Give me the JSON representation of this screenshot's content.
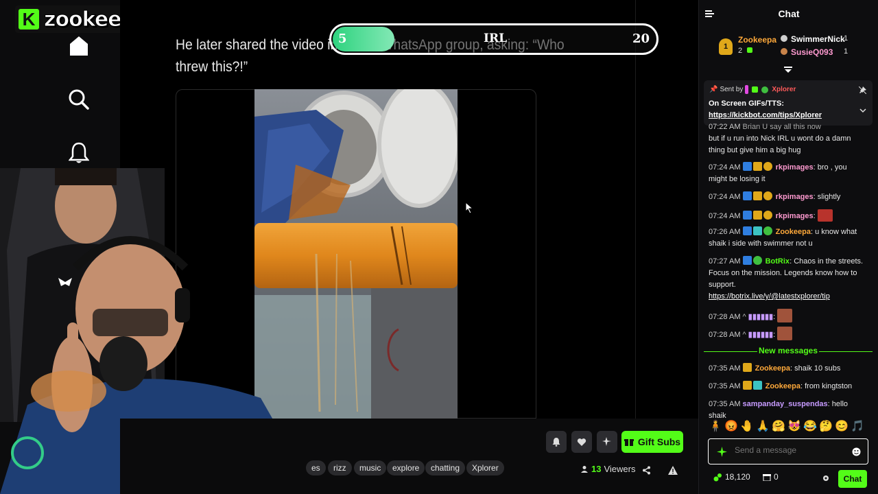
{
  "brand": {
    "logo_letter": "K",
    "logo_text": "zookeepa"
  },
  "nav": {
    "icons": [
      "home-icon",
      "search-icon",
      "bell-icon"
    ]
  },
  "article": {
    "text": "He later shared the video in a staff WhatsApp group, asking: “Who threw this?!”"
  },
  "overlay": {
    "left_value": "5",
    "center_label": "IRL",
    "right_value": "20",
    "progress": 0.19
  },
  "controls": {
    "gift_label": "Gift Subs",
    "viewers_count": "13",
    "viewers_label": "Viewers",
    "tags": [
      "es",
      "rizz",
      "music",
      "explore",
      "chatting",
      "Xplorer"
    ]
  },
  "chat": {
    "title": "Chat",
    "leaderboard": [
      {
        "rank": "1",
        "name": "Zookeepa",
        "count": "2"
      },
      {
        "name": "SwimmerNick",
        "count": "1"
      },
      {
        "name": "SusieQ093",
        "count": "1"
      }
    ],
    "pinned": {
      "sent_by_label": "Sent by",
      "sender": "Xplorer",
      "line1": "On Screen GIFs/TTS:",
      "link": "https://kickbot.com/tips/Xplorer"
    },
    "messages": [
      {
        "time": "07:22 AM",
        "user": "",
        "text": "but if u run into Nick IRL u wont do a damn thing but give him a big hug",
        "prefix": "Brian U say all this now"
      },
      {
        "time": "07:24 AM",
        "user": "rkpimages",
        "text": "bro , you might be losing it"
      },
      {
        "time": "07:24 AM",
        "user": "rkpimages",
        "text": "slightly"
      },
      {
        "time": "07:24 AM",
        "user": "rkpimages",
        "text": ""
      },
      {
        "time": "07:26 AM",
        "user": "Zookeepa",
        "text": "u know what shaik i side with swimmer not u"
      },
      {
        "time": "07:27 AM",
        "user": "BotRix",
        "text": "Chaos in the streets. Focus on the mission. Legends know how to support.",
        "link": "https://botrix.live/y/@latestxplorer/tip"
      },
      {
        "time": "07:28 AM",
        "user": "",
        "text": ""
      },
      {
        "time": "07:28 AM",
        "user": "",
        "text": ""
      }
    ],
    "new_messages_label": "New messages",
    "new_messages": [
      {
        "time": "07:35 AM",
        "user": "Zookeepa",
        "text": "shaik 10 subs"
      },
      {
        "time": "07:35 AM",
        "user": "Zookeepa",
        "text": "from kingtston"
      },
      {
        "time": "07:35 AM",
        "user": "sampanday_suspendas",
        "text": "hello shaik"
      }
    ],
    "input_placeholder": "Send a message",
    "points": "18,120",
    "other_count": "0",
    "chat_button": "Chat"
  },
  "colors": {
    "accent": "#53fc18",
    "bg": "#0b0b0c",
    "chat_bg": "#0d0d0f"
  }
}
